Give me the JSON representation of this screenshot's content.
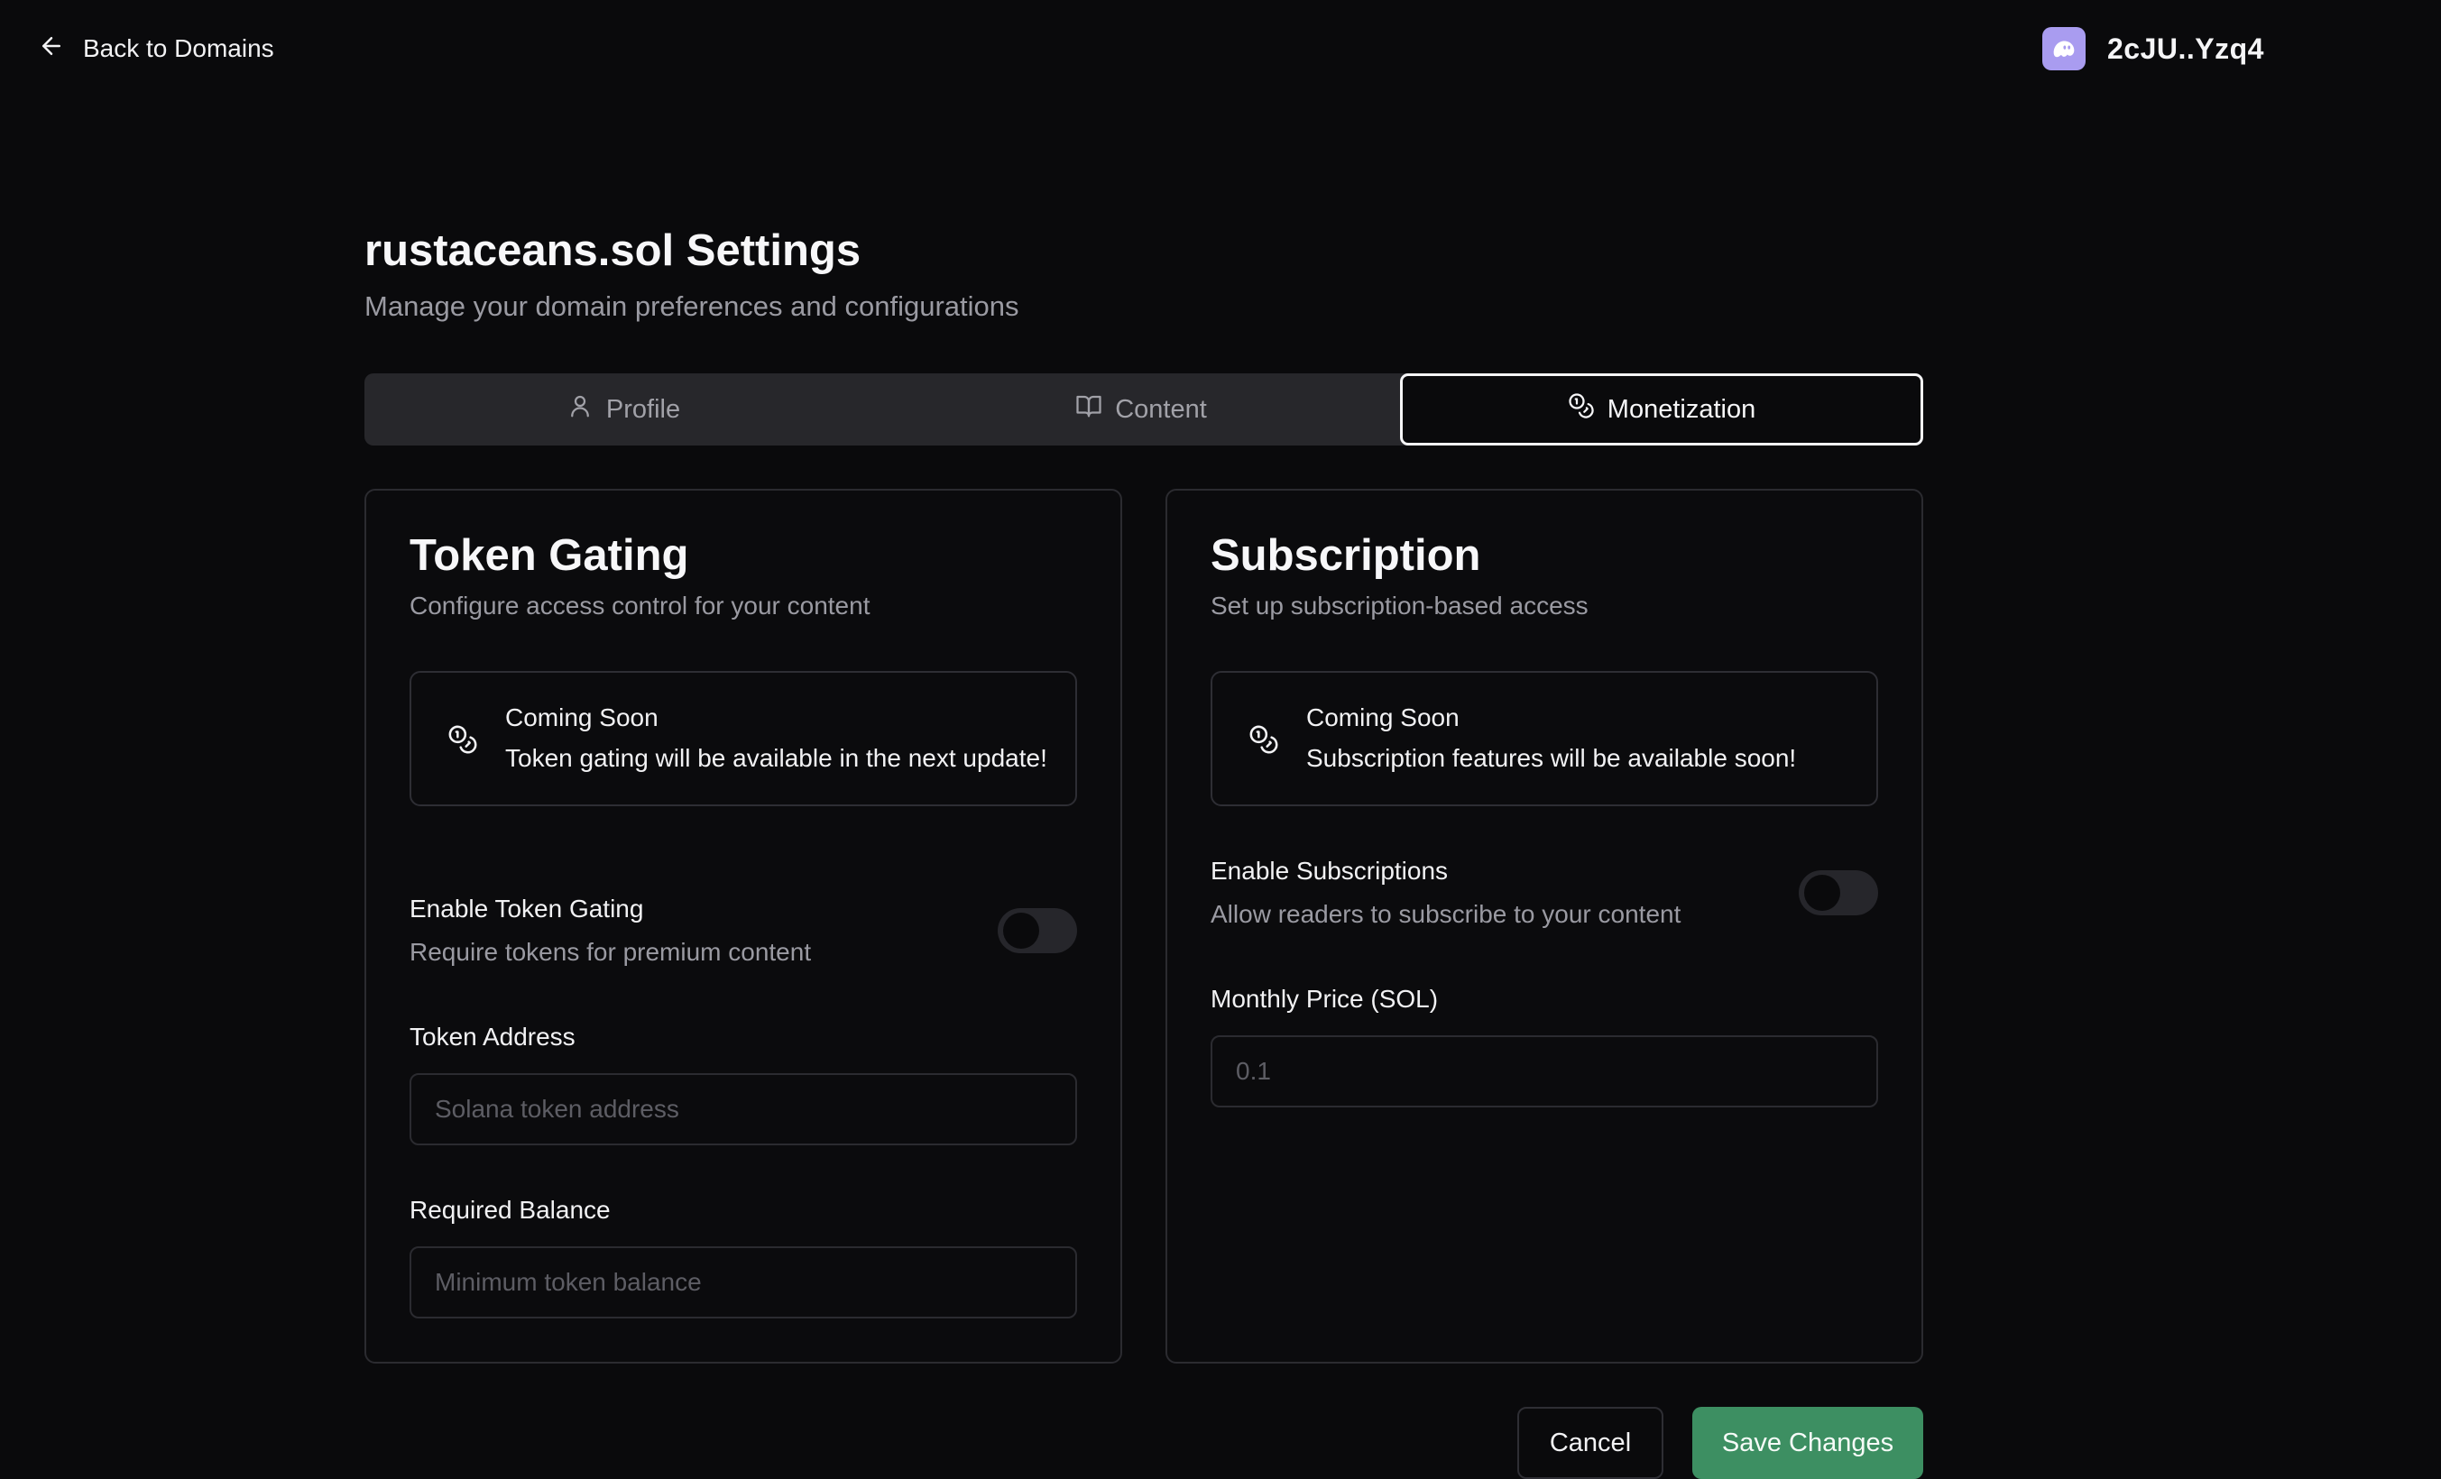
{
  "header": {
    "back_label": "Back to Domains",
    "wallet_address": "2cJU..Yzq4"
  },
  "page": {
    "title": "rustaceans.sol Settings",
    "subtitle": "Manage your domain preferences and configurations"
  },
  "tabs": [
    {
      "label": "Profile",
      "icon": "user-icon",
      "active": false
    },
    {
      "label": "Content",
      "icon": "book-icon",
      "active": false
    },
    {
      "label": "Monetization",
      "icon": "coins-icon",
      "active": true
    }
  ],
  "token_gating": {
    "title": "Token Gating",
    "subtitle": "Configure access control for your content",
    "notice_heading": "Coming Soon",
    "notice_body": "Token gating will be available in the next update!",
    "toggle_label": "Enable Token Gating",
    "toggle_desc": "Require tokens for premium content",
    "toggle_on": false,
    "token_address_label": "Token Address",
    "token_address_placeholder": "Solana token address",
    "required_balance_label": "Required Balance",
    "required_balance_placeholder": "Minimum token balance"
  },
  "subscription": {
    "title": "Subscription",
    "subtitle": "Set up subscription-based access",
    "notice_heading": "Coming Soon",
    "notice_body": "Subscription features will be available soon!",
    "toggle_label": "Enable Subscriptions",
    "toggle_desc": "Allow readers to subscribe to your content",
    "toggle_on": false,
    "price_label": "Monthly Price (SOL)",
    "price_placeholder": "0.1"
  },
  "footer": {
    "cancel_label": "Cancel",
    "save_label": "Save Changes"
  },
  "colors": {
    "background": "#0a0a0c",
    "save_button": "#3d8f62",
    "wallet_avatar": "#a99cf0"
  }
}
